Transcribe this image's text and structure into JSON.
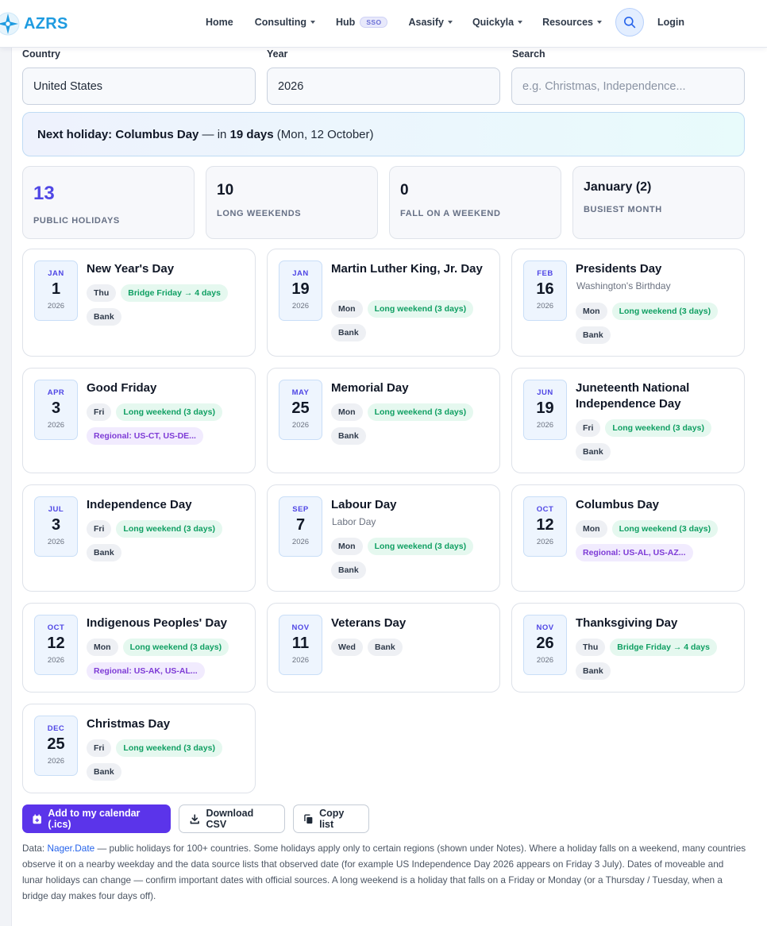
{
  "brand": {
    "name": "AZRS",
    "accent": "#1e9be0"
  },
  "nav": {
    "items": [
      {
        "label": "Home",
        "dropdown": false
      },
      {
        "label": "Consulting",
        "dropdown": true
      },
      {
        "label": "Hub",
        "dropdown": false,
        "badge": "SSO"
      },
      {
        "label": "Asasify",
        "dropdown": true
      },
      {
        "label": "Quickyla",
        "dropdown": true
      },
      {
        "label": "Resources",
        "dropdown": true
      }
    ],
    "search_icon": "search-icon",
    "login": "Login"
  },
  "filters": {
    "country_label": "Country",
    "country_value": "United States",
    "year_label": "Year",
    "year_value": "2026",
    "search_label": "Search",
    "search_placeholder": "e.g. Christmas, Independence..."
  },
  "next_holiday": {
    "prefix": "Next holiday: ",
    "name": "Columbus Day",
    "sep": " — in ",
    "days": "19 days",
    "date": " (Mon, 12 October)"
  },
  "stats": [
    {
      "value": "13",
      "label": "PUBLIC HOLIDAYS"
    },
    {
      "value": "10",
      "label": "LONG WEEKENDS"
    },
    {
      "value": "0",
      "label": "FALL ON A WEEKEND"
    },
    {
      "value": "January (2)",
      "label": "BUSIEST MONTH"
    }
  ],
  "holidays": [
    {
      "mon": "JAN",
      "day": "1",
      "year": "2026",
      "name": "New Year's Day",
      "local": "",
      "weekday": "Thu",
      "tag": "Bridge Friday → 4 days",
      "type": "Bank",
      "region": ""
    },
    {
      "mon": "JAN",
      "day": "19",
      "year": "2026",
      "name": "Martin Luther King, Jr. Day",
      "local": "",
      "weekday": "Mon",
      "tag": "Long weekend (3 days)",
      "type": "Bank",
      "region": ""
    },
    {
      "mon": "FEB",
      "day": "16",
      "year": "2026",
      "name": "Presidents Day",
      "local": "Washington's Birthday",
      "weekday": "Mon",
      "tag": "Long weekend (3 days)",
      "type": "Bank",
      "region": ""
    },
    {
      "mon": "APR",
      "day": "3",
      "year": "2026",
      "name": "Good Friday",
      "local": "",
      "weekday": "Fri",
      "tag": "Long weekend (3 days)",
      "type": "",
      "region": "Regional: US-CT, US-DE..."
    },
    {
      "mon": "MAY",
      "day": "25",
      "year": "2026",
      "name": "Memorial Day",
      "local": "",
      "weekday": "Mon",
      "tag": "Long weekend (3 days)",
      "type": "Bank",
      "region": ""
    },
    {
      "mon": "JUN",
      "day": "19",
      "year": "2026",
      "name": "Juneteenth National Independence Day",
      "local": "",
      "weekday": "Fri",
      "tag": "Long weekend (3 days)",
      "type": "Bank",
      "region": ""
    },
    {
      "mon": "JUL",
      "day": "3",
      "year": "2026",
      "name": "Independence Day",
      "local": "",
      "weekday": "Fri",
      "tag": "Long weekend (3 days)",
      "type": "Bank",
      "region": ""
    },
    {
      "mon": "SEP",
      "day": "7",
      "year": "2026",
      "name": "Labour Day",
      "local": "Labor Day",
      "weekday": "Mon",
      "tag": "Long weekend (3 days)",
      "type": "Bank",
      "region": ""
    },
    {
      "mon": "OCT",
      "day": "12",
      "year": "2026",
      "name": "Columbus Day",
      "local": "",
      "weekday": "Mon",
      "tag": "Long weekend (3 days)",
      "type": "",
      "region": "Regional: US-AL, US-AZ..."
    },
    {
      "mon": "OCT",
      "day": "12",
      "year": "2026",
      "name": "Indigenous Peoples' Day",
      "local": "",
      "weekday": "Mon",
      "tag": "Long weekend (3 days)",
      "type": "",
      "region": "Regional: US-AK, US-AL..."
    },
    {
      "mon": "NOV",
      "day": "11",
      "year": "2026",
      "name": "Veterans Day",
      "local": "",
      "weekday": "Wed",
      "tag": "",
      "type": "Bank",
      "region": ""
    },
    {
      "mon": "NOV",
      "day": "26",
      "year": "2026",
      "name": "Thanksgiving Day",
      "local": "",
      "weekday": "Thu",
      "tag": "Bridge Friday → 4 days",
      "type": "Bank",
      "region": ""
    },
    {
      "mon": "DEC",
      "day": "25",
      "year": "2026",
      "name": "Christmas Day",
      "local": "",
      "weekday": "Fri",
      "tag": "Long weekend (3 days)",
      "type": "Bank",
      "region": ""
    }
  ],
  "actions": {
    "add_calendar": "Add to my calendar (.ics)",
    "download_csv": "Download CSV",
    "copy_list": "Copy list"
  },
  "footnote": {
    "prefix": "Data: ",
    "link": "Nager.Date",
    "text": " — public holidays for 100+ countries. Some holidays apply only to certain regions (shown under Notes). Where a holiday falls on a weekend, many countries observe it on a nearby weekday and the data source lists that observed date (for example US Independence Day 2026 appears on Friday 3 July). Dates of moveable and lunar holidays can change — confirm important dates with official sources. A long weekend is a holiday that falls on a Friday or Monday (or a Thursday / Tuesday, when a bridge day makes four days off)."
  },
  "colors": {
    "primary": "#5b34ea",
    "accent_indigo": "#4f46e5",
    "long_weekend_green": "#0f9f62",
    "regional_purple": "#7e3bd6"
  }
}
